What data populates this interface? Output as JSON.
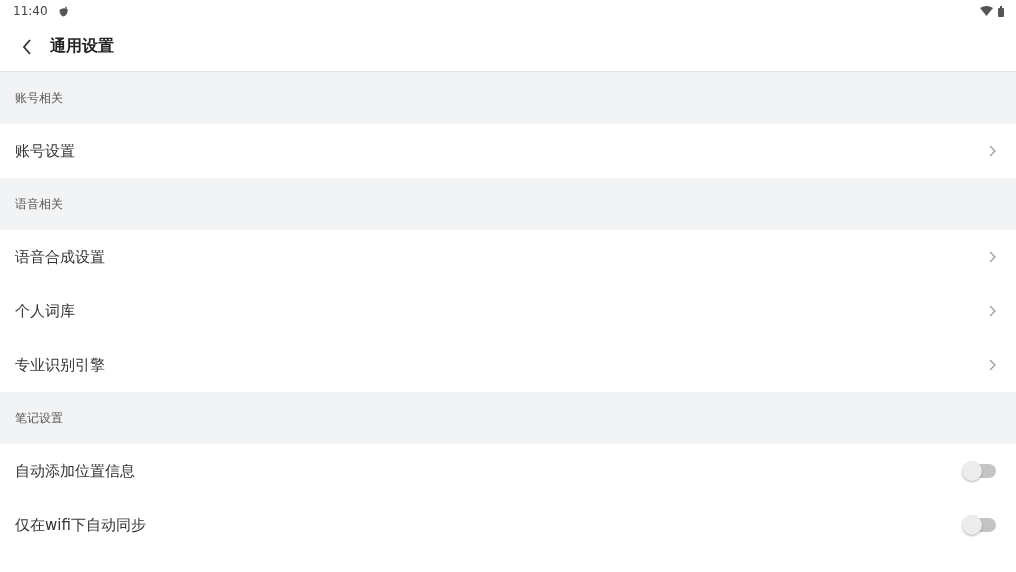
{
  "status_bar": {
    "time": "11:40"
  },
  "header": {
    "title": "通用设置"
  },
  "sections": [
    {
      "title": "账号相关",
      "items": [
        {
          "kind": "link",
          "label": "账号设置"
        }
      ]
    },
    {
      "title": "语音相关",
      "items": [
        {
          "kind": "link",
          "label": "语音合成设置"
        },
        {
          "kind": "link",
          "label": "个人词库"
        },
        {
          "kind": "link",
          "label": "专业识别引擎"
        }
      ]
    },
    {
      "title": "笔记设置",
      "items": [
        {
          "kind": "toggle",
          "label": "自动添加位置信息",
          "on": false
        },
        {
          "kind": "toggle",
          "label": "仅在wifi下自动同步",
          "on": false
        }
      ]
    }
  ]
}
